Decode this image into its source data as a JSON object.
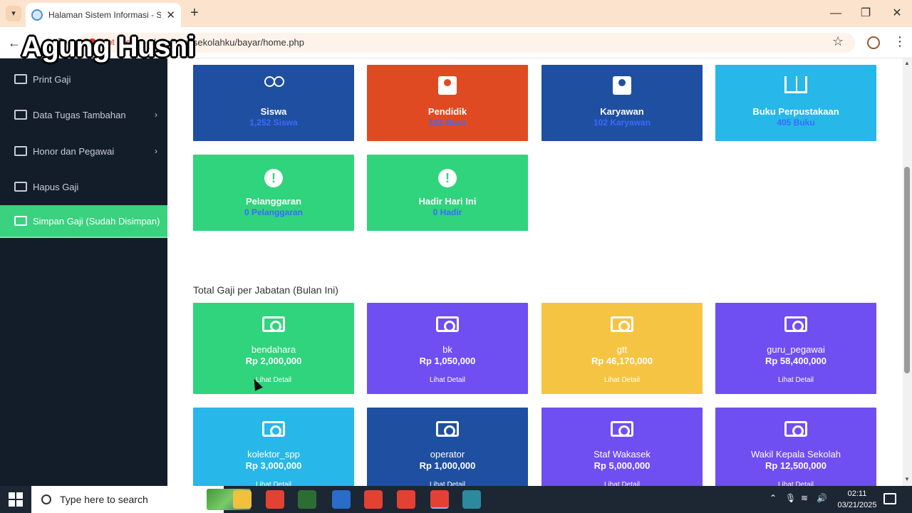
{
  "browser": {
    "tab_title": "Halaman Sistem Informasi - SM",
    "tab_close": "✕",
    "new_tab": "+",
    "security_warning": "Not secure",
    "url": "localhost/sekolahku/bayar/home.php",
    "window_controls": {
      "minimize": "—",
      "restore": "❐",
      "close": "✕"
    }
  },
  "watermark": "Agung Husni",
  "sidebar": {
    "items": [
      {
        "label": "Print Gaji",
        "icon": "printer-icon",
        "has_submenu": false,
        "active": false
      },
      {
        "label": "Data Tugas Tambahan",
        "icon": "wallet-icon",
        "has_submenu": true,
        "active": false
      },
      {
        "label": "Honor dan Pegawai",
        "icon": "wallet-icon",
        "has_submenu": true,
        "active": false
      },
      {
        "label": "Hapus Gaji",
        "icon": "trash-icon",
        "has_submenu": false,
        "active": false
      },
      {
        "label": "Simpan Gaji (Sudah Disimpan)",
        "icon": "money-icon",
        "has_submenu": false,
        "active": true
      }
    ]
  },
  "stats": [
    {
      "title": "Siswa",
      "value": "1,252 Siswa",
      "icon": "users-icon",
      "color": "#1f4fa0"
    },
    {
      "title": "Pendidik",
      "value": "102 Guru",
      "icon": "person-badge-icon",
      "color": "#e04a22"
    },
    {
      "title": "Karyawan",
      "value": "102 Karyawan",
      "icon": "person-badge-icon",
      "color": "#1f4fa0"
    },
    {
      "title": "Buku Perpustakaan",
      "value": "405 Buku",
      "icon": "book-icon",
      "color": "#27b7e8"
    },
    {
      "title": "Pelanggaran",
      "value": "0 Pelanggaran",
      "icon": "alert-icon",
      "color": "#2fd47c"
    },
    {
      "title": "Hadir Hari Ini",
      "value": "0 Hadir",
      "icon": "alert-icon",
      "color": "#2fd47c"
    }
  ],
  "salary_section": {
    "title": "Total Gaji per Jabatan (Bulan Ini)",
    "detail_label": "Lihat Detail",
    "items": [
      {
        "role": "bendahara",
        "amount": "Rp 2,000,000",
        "color": "#2fd47c"
      },
      {
        "role": "bk",
        "amount": "Rp 1,050,000",
        "color": "#6f4ef2"
      },
      {
        "role": "gtt",
        "amount": "Rp 46,170,000",
        "color": "#f6c443"
      },
      {
        "role": "guru_pegawai",
        "amount": "Rp 58,400,000",
        "color": "#6f4ef2"
      },
      {
        "role": "kolektor_spp",
        "amount": "Rp 3,000,000",
        "color": "#27b7e8"
      },
      {
        "role": "operator",
        "amount": "Rp 1,000,000",
        "color": "#1f4fa0"
      },
      {
        "role": "Staf Wakasek",
        "amount": "Rp 5,000,000",
        "color": "#6f4ef2"
      },
      {
        "role": "Wakil Kepala Sekolah",
        "amount": "Rp 12,500,000",
        "color": "#6f4ef2"
      }
    ]
  },
  "taskbar": {
    "search_placeholder": "Type here to search",
    "apps": [
      "file-explorer-icon",
      "chrome-icon",
      "dreamweaver-icon",
      "app-icon",
      "chrome-icon",
      "chrome-icon",
      "chrome-icon",
      "app-icon"
    ],
    "time": "02:11",
    "date": "03/21/2025"
  }
}
